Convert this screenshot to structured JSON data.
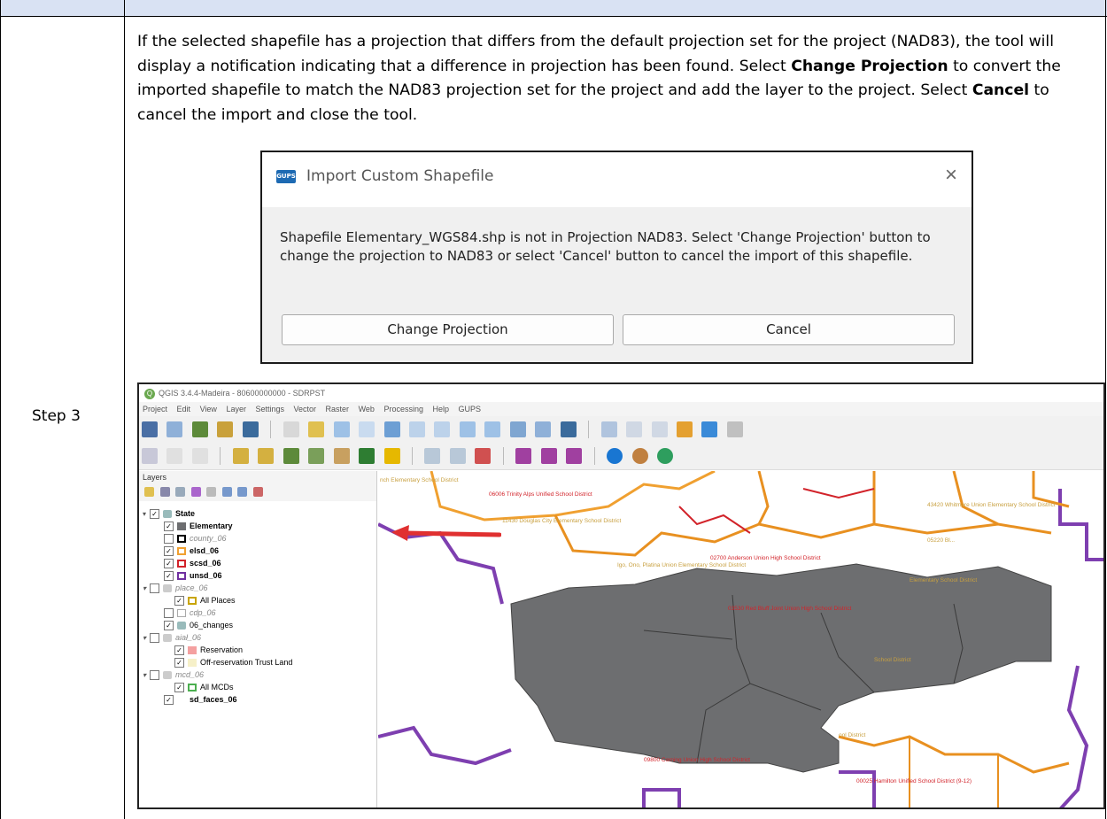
{
  "document": {
    "step_label": "Step 3",
    "paragraph": {
      "part1": "If the selected shapefile has a projection that differs from the default projection set for the project (NAD83), the tool will display a notification indicating that a difference in projection has been found. Select ",
      "bold1": "Change Projection",
      "part2": " to convert the imported shapefile to match the NAD83 projection set for the project and add the layer to the project. Select ",
      "bold2": "Cancel",
      "part3": " to cancel the import and close the tool."
    }
  },
  "dialog": {
    "icon_text": "GUPS",
    "title": "Import Custom Shapefile",
    "close_glyph": "×",
    "message": "Shapefile Elementary_WGS84.shp is not in Projection NAD83. Select 'Change Projection' button to change the projection to NAD83 or select 'Cancel' button to cancel the import of this shapefile.",
    "change_button": "Change Projection",
    "cancel_button": "Cancel"
  },
  "qgis": {
    "window_title": "QGIS 3.4.4-Madeira - 80600000000 - SDRPST",
    "menu": [
      "Project",
      "Edit",
      "View",
      "Layer",
      "Settings",
      "Vector",
      "Raster",
      "Web",
      "Processing",
      "Help",
      "GUPS"
    ],
    "layers_panel_title": "Layers",
    "layers": [
      {
        "name": "State",
        "checked": "✓",
        "indent": 0
      },
      {
        "name": "Elementary",
        "checked": "✓",
        "indent": 1,
        "color": "#6d6e70",
        "bold": true
      },
      {
        "name": "county_06",
        "checked": "",
        "indent": 1,
        "color": "#000000"
      },
      {
        "name": "elsd_06",
        "checked": "✓",
        "indent": 1,
        "color": "#f0a030"
      },
      {
        "name": "scsd_06",
        "checked": "✓",
        "indent": 1,
        "color": "#d2232a"
      },
      {
        "name": "unsd_06",
        "checked": "✓",
        "indent": 1,
        "color": "#7030a0"
      },
      {
        "name": "place_06",
        "checked": "",
        "indent": 0
      },
      {
        "name": "All Places",
        "checked": "✓",
        "indent": 2,
        "color": "#c8a400"
      },
      {
        "name": "cdp_06",
        "checked": "",
        "indent": 1
      },
      {
        "name": "06_changes",
        "checked": "✓",
        "indent": 1
      },
      {
        "name": "aiał_06",
        "checked": "",
        "indent": 0
      },
      {
        "name": "Reservation",
        "checked": "✓",
        "indent": 2,
        "color": "#f4a0a0"
      },
      {
        "name": "Off-reservation Trust Land",
        "checked": "✓",
        "indent": 2,
        "color": "#f6f0c8"
      },
      {
        "name": "mcd_06",
        "checked": "",
        "indent": 0
      },
      {
        "name": "All MCDs",
        "checked": "✓",
        "indent": 2,
        "color": "#4caf50"
      },
      {
        "name": "sd_faces_06",
        "checked": "✓",
        "indent": 1
      }
    ],
    "map_labels": [
      "nch Elementary School District",
      "06006 Trinity Alps Unified School District",
      "11430 Douglas City Elementary School District",
      "02700 Anderson Union High School District",
      "Igo, Ono, Platina Union Elementary School District",
      "43420 Whitmore Union Elementary School District",
      "05220 Bl...",
      "03530 Red Bluff Joint Union High School District",
      "09800 Corning Union High School District",
      "00025 Hamilton Unified School District (9-12)",
      "Elementary School District",
      "School District",
      "ool District"
    ]
  }
}
